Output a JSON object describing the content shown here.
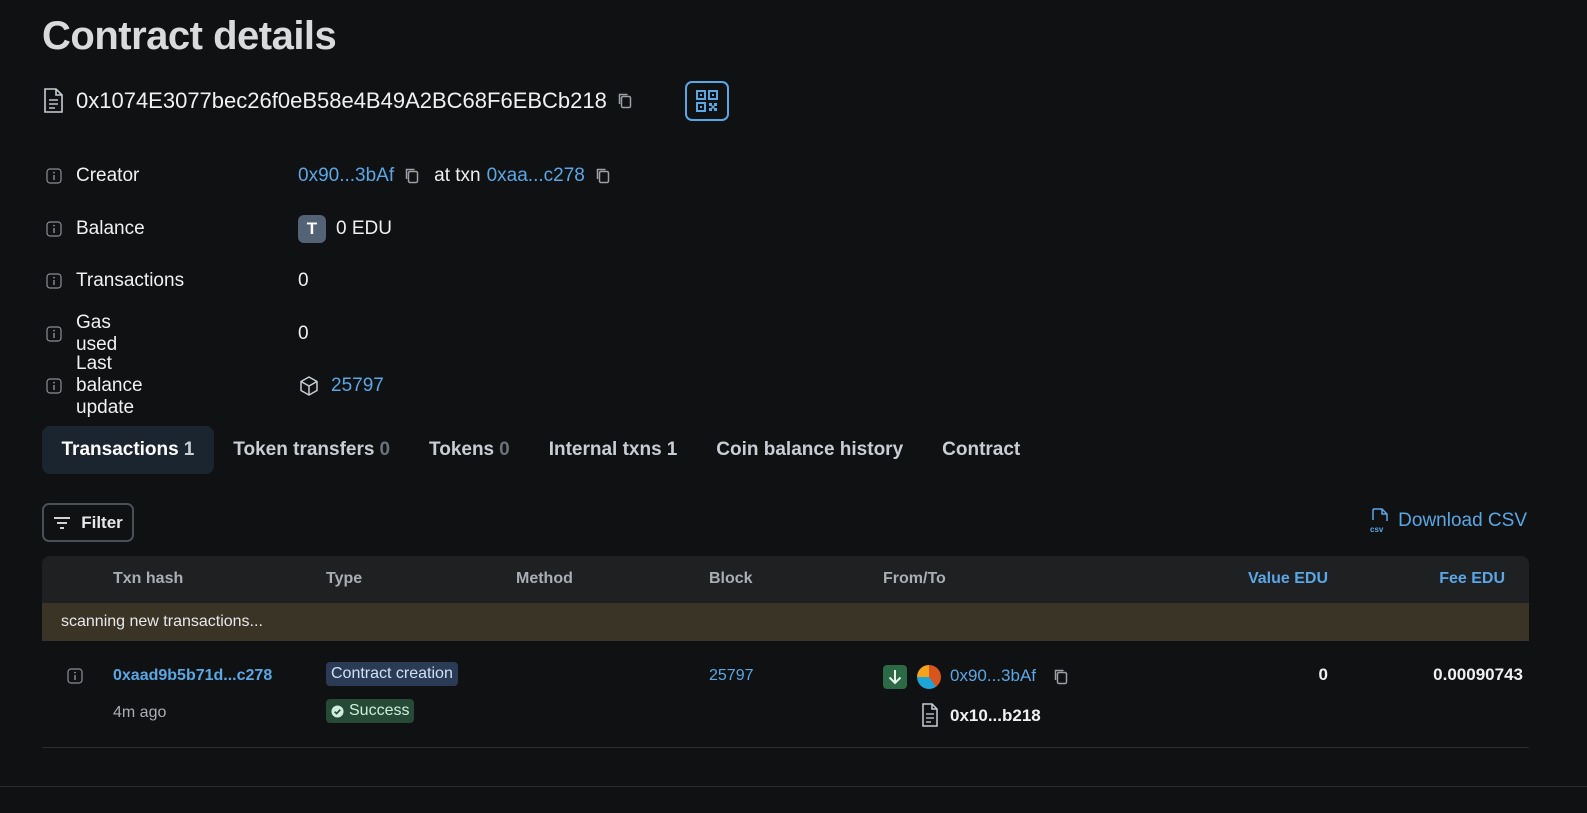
{
  "page": {
    "title": "Contract details"
  },
  "contract": {
    "address": "0x1074E3077bec26f0eB58e4B49A2BC68F6EBCb218"
  },
  "details": {
    "creator": {
      "label": "Creator",
      "address": "0x90...3bAf",
      "at_txn_text": "at txn",
      "txn": "0xaa...c278"
    },
    "balance": {
      "label": "Balance",
      "token_letter": "T",
      "value": "0 EDU"
    },
    "transactions": {
      "label": "Transactions",
      "value": "0"
    },
    "gas_used": {
      "label": "Gas used",
      "value": "0"
    },
    "last_balance_update": {
      "label": "Last balance update",
      "block": "25797"
    }
  },
  "tabs": [
    {
      "label": "Transactions",
      "count": "1",
      "active": true
    },
    {
      "label": "Token transfers",
      "count": "0"
    },
    {
      "label": "Tokens",
      "count": "0"
    },
    {
      "label": "Internal txns",
      "count": "1"
    },
    {
      "label": "Coin balance history",
      "count": ""
    },
    {
      "label": "Contract",
      "count": ""
    }
  ],
  "toolbar": {
    "filter_label": "Filter",
    "download_label": "Download CSV",
    "csv_icon_text": "csv"
  },
  "table": {
    "headers": {
      "txn_hash": "Txn hash",
      "type": "Type",
      "method": "Method",
      "block": "Block",
      "from_to": "From/To",
      "value": "Value EDU",
      "fee": "Fee EDU"
    },
    "scanning_text": "scanning new transactions...",
    "rows": [
      {
        "hash": "0xaad9b5b71d...c278",
        "age": "4m ago",
        "type": "Contract creation",
        "status": "Success",
        "method": "",
        "block": "25797",
        "from": "0x90...3bAf",
        "to": "0x10...b218",
        "value": "0",
        "fee": "0.00090743"
      }
    ]
  },
  "colors": {
    "accent": "#5aa7e6",
    "background": "#101112",
    "success": "#264a35",
    "scan_bg": "#3a3427"
  },
  "icons": [
    "document-icon",
    "copy-icon",
    "qr-code-icon",
    "info-icon",
    "cube-icon",
    "filter-icon",
    "csv-file-icon",
    "arrow-down-icon",
    "check-circle-icon",
    "avatar-icon"
  ]
}
